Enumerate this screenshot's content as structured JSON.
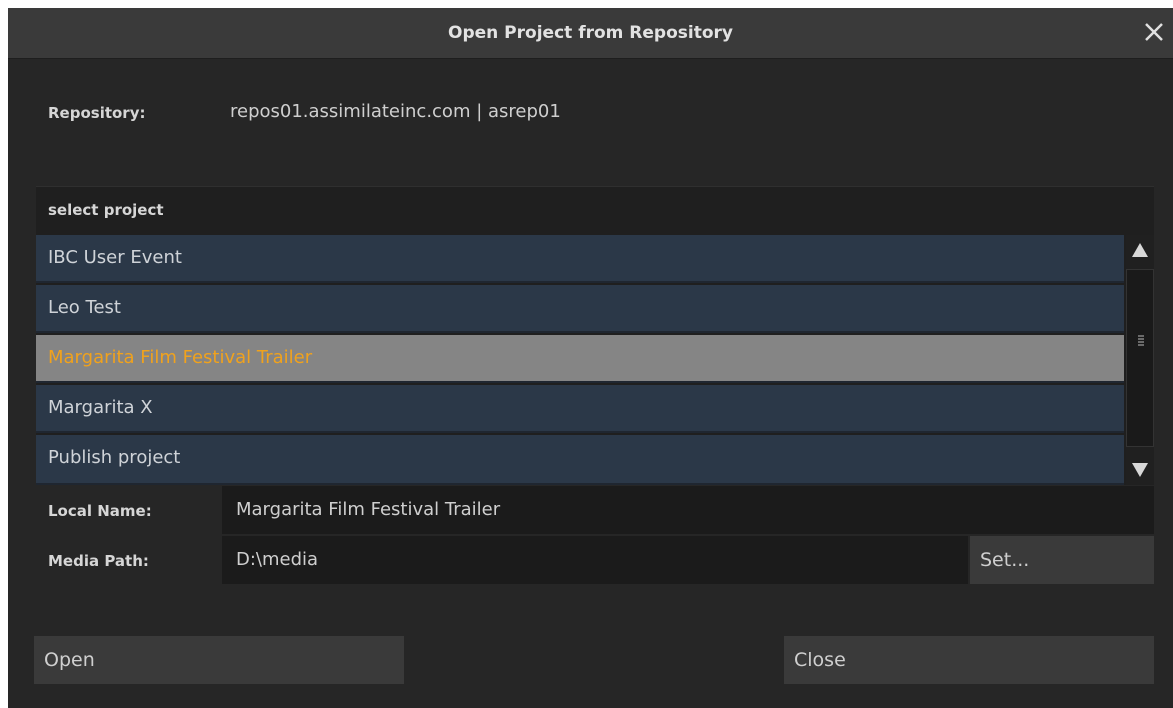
{
  "dialog": {
    "title": "Open Project from Repository",
    "close_icon": "close-icon"
  },
  "repository": {
    "label": "Repository:",
    "value": "repos01.assimilateinc.com | asrep01"
  },
  "project_list": {
    "header": "select project",
    "items": [
      {
        "label": "IBC User Event",
        "selected": false
      },
      {
        "label": "Leo Test",
        "selected": false
      },
      {
        "label": "Margarita Film Festival Trailer",
        "selected": true
      },
      {
        "label": "Margarita X",
        "selected": false
      },
      {
        "label": "Publish project",
        "selected": false
      }
    ],
    "selected_color": "#f0a21d",
    "row_color": "#2b3848"
  },
  "local_name": {
    "label": "Local Name:",
    "value": "Margarita Film Festival Trailer"
  },
  "media_path": {
    "label": "Media Path:",
    "value": "D:\\media",
    "set_label": "Set..."
  },
  "buttons": {
    "open_label": "Open",
    "close_label": "Close"
  }
}
